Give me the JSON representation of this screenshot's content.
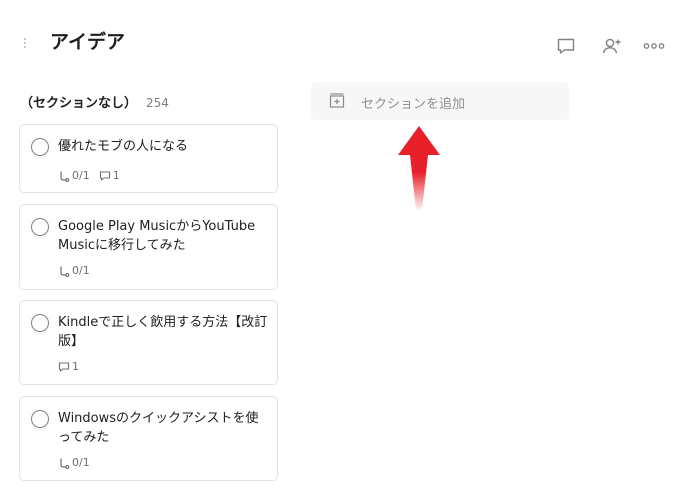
{
  "header": {
    "title": "アイデア",
    "icons": {
      "comment": "comment-icon",
      "share": "add-person-icon",
      "more": "more-horizontal-icon"
    }
  },
  "section": {
    "title": "（セクションなし）",
    "count": "254"
  },
  "tasks": [
    {
      "title": "優れたモブの人になる",
      "subtasks": "0/1",
      "comments": "1"
    },
    {
      "title": "Google Play MusicからYouTube Musicに移行してみた",
      "subtasks": "0/1"
    },
    {
      "title": "Kindleで正しく飲用する方法【改訂版】",
      "comments": "1"
    },
    {
      "title": "Windowsのクイックアシストを使ってみた",
      "subtasks": "0/1"
    }
  ],
  "add_section": {
    "label": "セクションを追加",
    "icon": "add-section-icon"
  },
  "colors": {
    "arrow": "#e8202a",
    "text": "#202020",
    "muted": "#808080",
    "border": "#e3e3e3"
  }
}
